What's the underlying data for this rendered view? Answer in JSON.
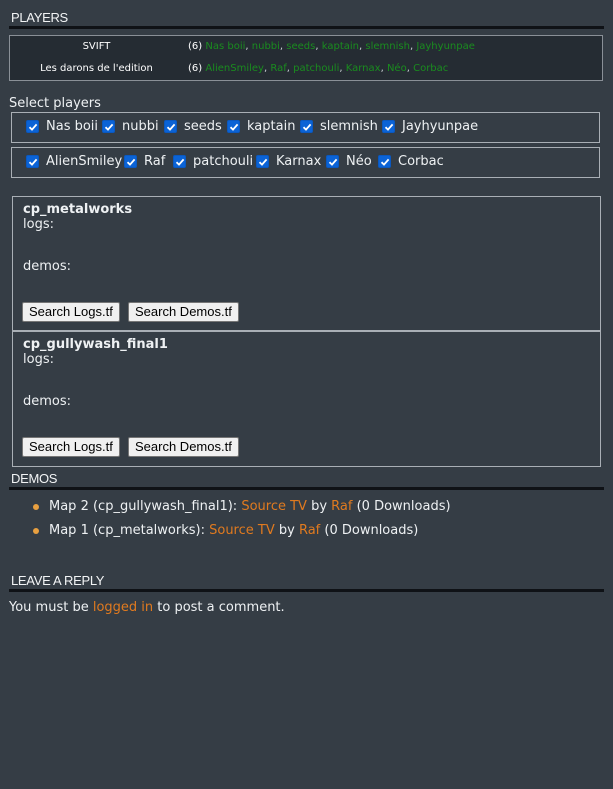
{
  "players_section": {
    "title": "PLAYERS"
  },
  "rosters": [
    {
      "team": "SVIFT",
      "count": "(6)",
      "players": [
        "Nas boii",
        "nubbi",
        "seeds",
        "kaptain",
        "slemnish",
        "Jayhyunpae"
      ]
    },
    {
      "team": "Les darons de l'edition",
      "count": "(6)",
      "players": [
        "AlienSmiley",
        "Raf",
        "patchouli",
        "Karnax",
        "Néo",
        "Corbac"
      ]
    }
  ],
  "select_players": {
    "label": "Select players",
    "rows": [
      [
        "Nas boii",
        "nubbi",
        "seeds",
        "kaptain",
        "slemnish",
        "Jayhyunpae"
      ],
      [
        "AlienSmiley",
        "Raf",
        "patchouli",
        "Karnax",
        "Néo",
        "Corbac"
      ]
    ]
  },
  "maps": [
    {
      "name": "cp_metalworks",
      "logs_label": "logs:",
      "demos_label": "demos:",
      "search_logs": "Search Logs.tf",
      "search_demos": "Search Demos.tf"
    },
    {
      "name": "cp_gullywash_final1",
      "logs_label": "logs:",
      "demos_label": "demos:",
      "search_logs": "Search Logs.tf",
      "search_demos": "Search Demos.tf"
    }
  ],
  "demos_section": {
    "title": "DEMOS",
    "items": [
      {
        "prefix": "Map 2 (cp_gullywash_final1): ",
        "link": "Source TV",
        "by": " by ",
        "author": "Raf",
        "downloads": " (0 Downloads)"
      },
      {
        "prefix": "Map 1 (cp_metalworks): ",
        "link": "Source TV",
        "by": " by ",
        "author": "Raf",
        "downloads": " (0 Downloads)"
      }
    ]
  },
  "reply_section": {
    "title": "LEAVE A REPLY",
    "text_before": "You must be ",
    "link": "logged in",
    "text_after": " to post a comment."
  },
  "colors": {
    "background": "#353d45",
    "player_link": "#1a8c1f",
    "orange_link": "#e07a1f",
    "checkbox": "#0b63d6"
  }
}
